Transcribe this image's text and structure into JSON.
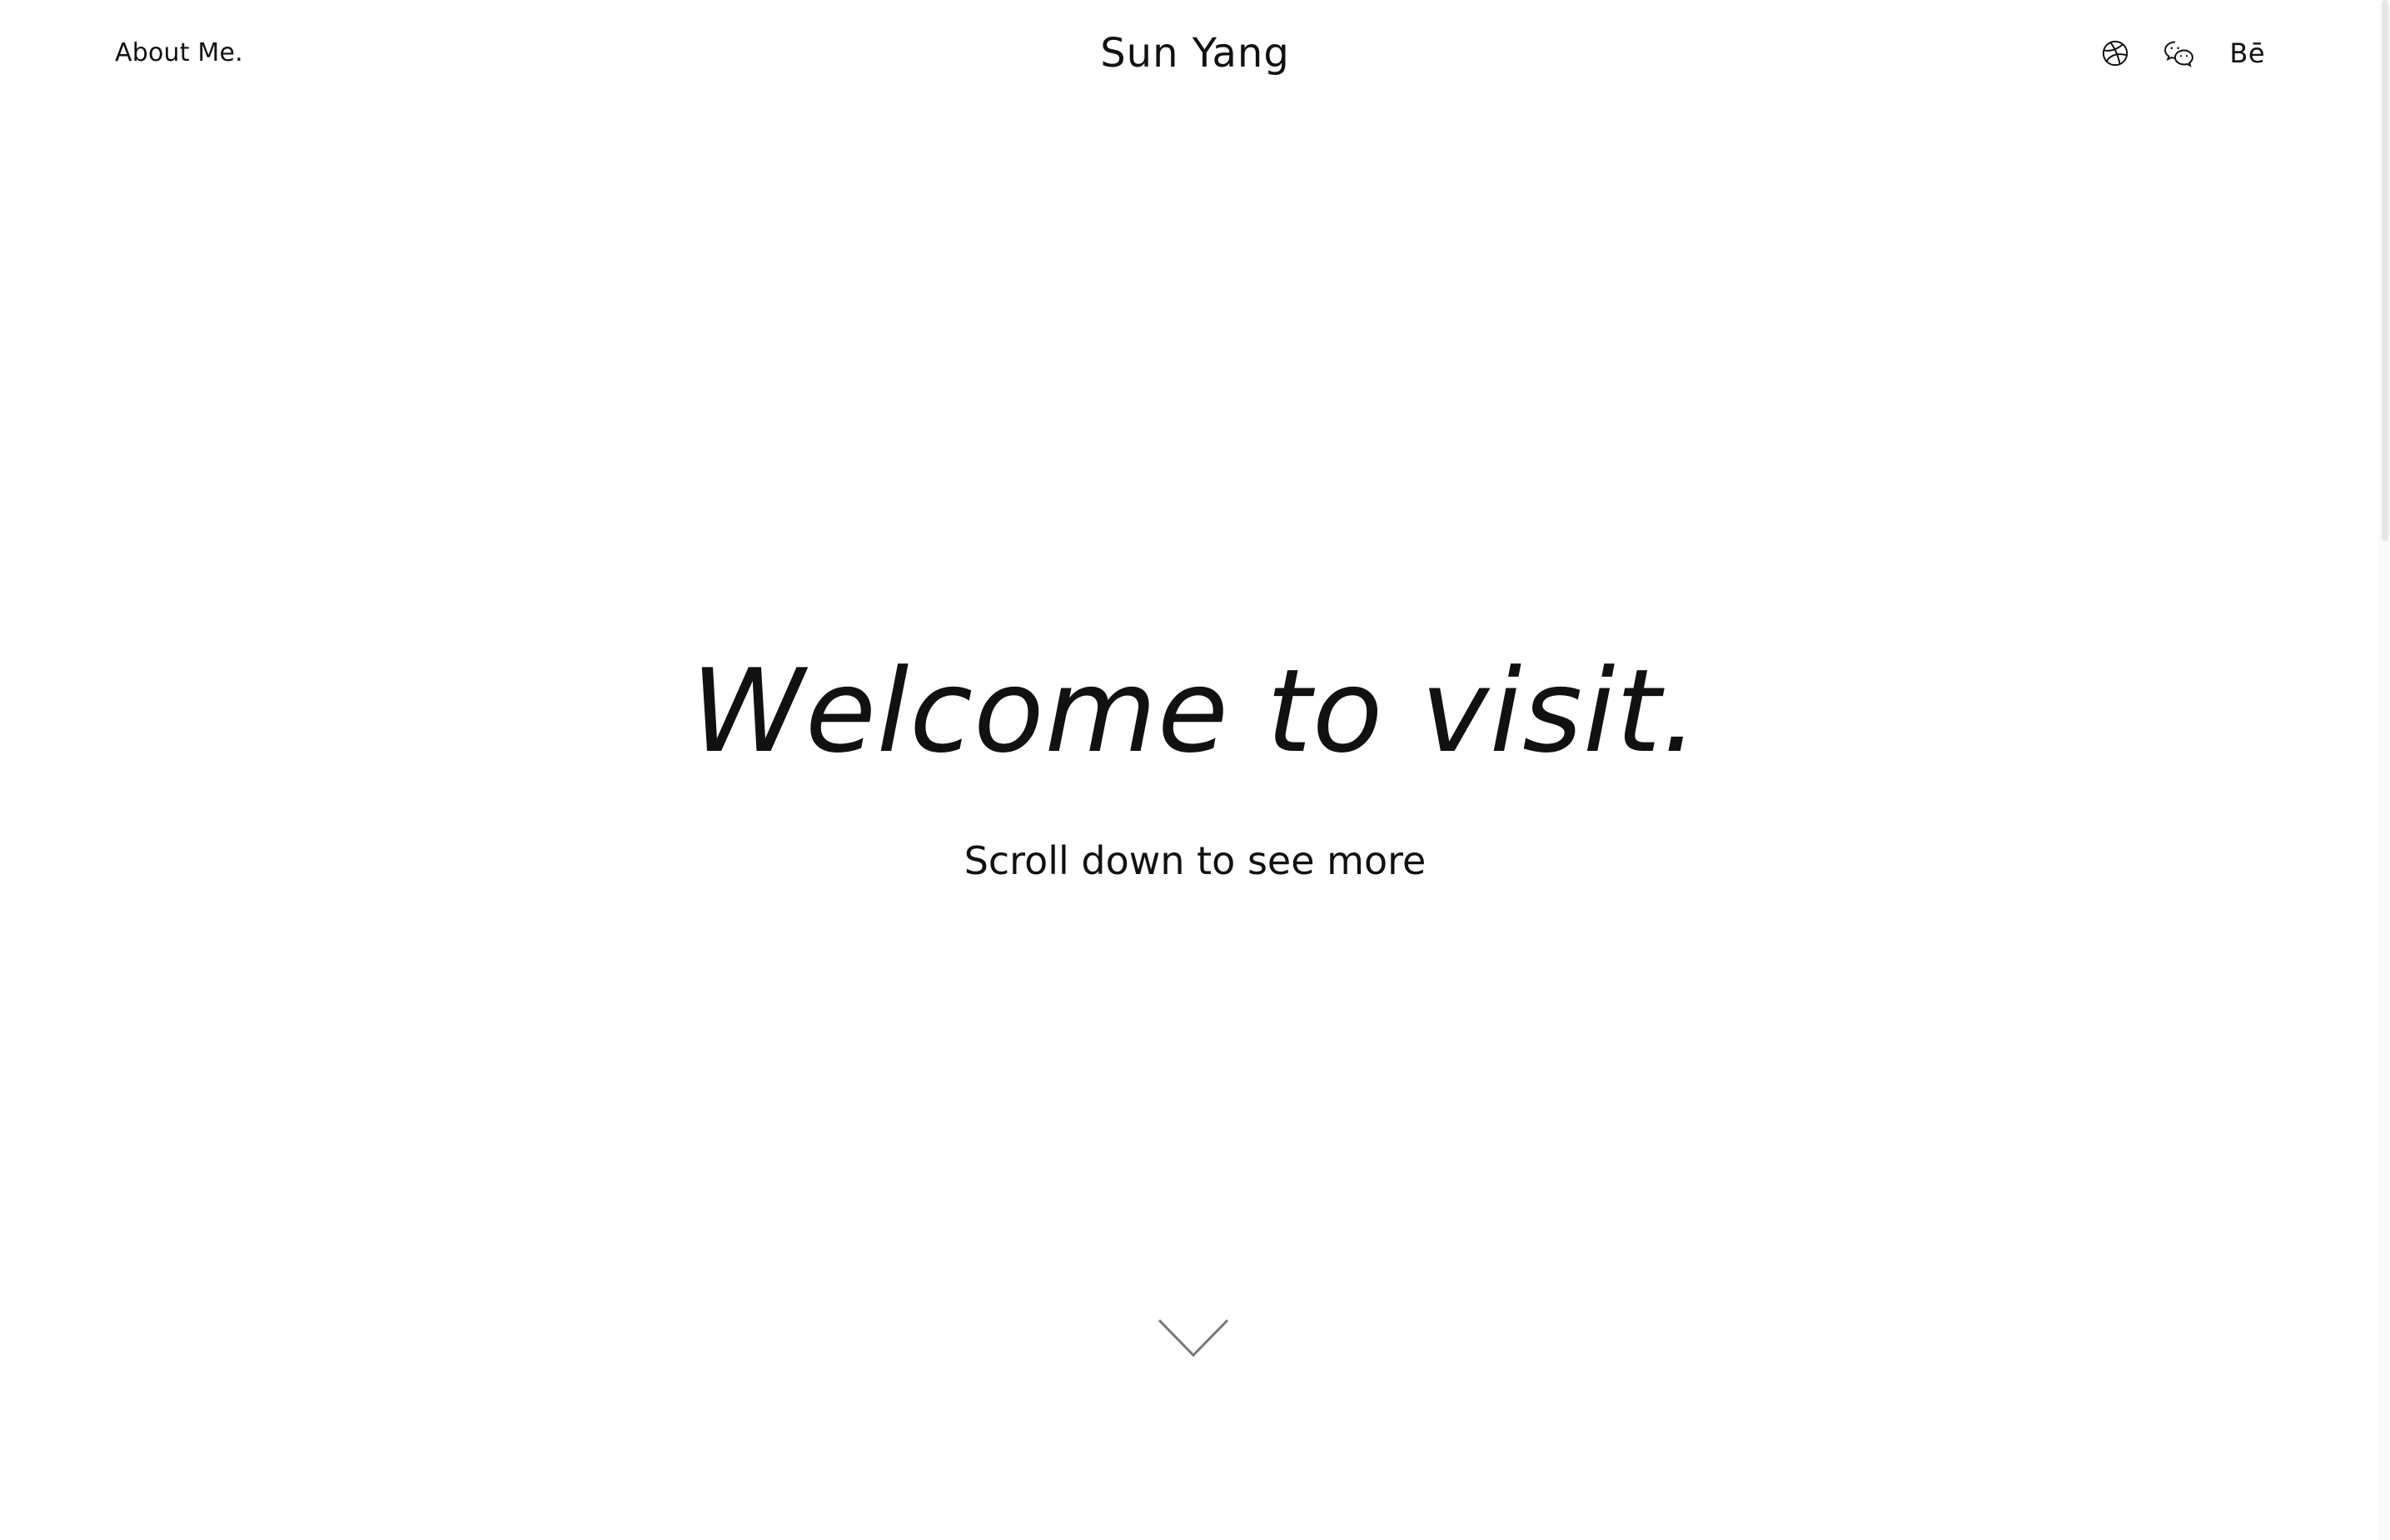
{
  "header": {
    "about_label": "About Me.",
    "site_title": "Sun Yang",
    "social": [
      {
        "name": "dribbble",
        "icon": "dribbble-icon"
      },
      {
        "name": "wechat",
        "icon": "wechat-icon"
      },
      {
        "name": "behance",
        "icon": "behance-icon",
        "text": "Bē"
      }
    ]
  },
  "hero": {
    "heading": "Welcome to visit.",
    "subtitle": "Scroll down to see more",
    "scroll_icon": "chevron-down-icon"
  },
  "colors": {
    "text": "#111111",
    "background": "#ffffff",
    "chevron": "#777777"
  }
}
